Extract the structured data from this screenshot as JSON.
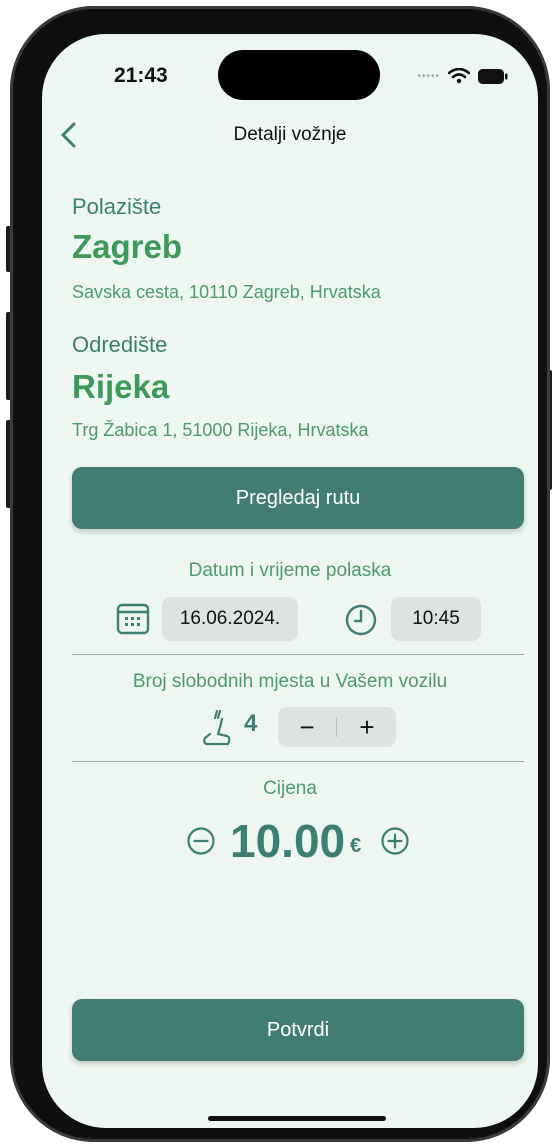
{
  "status_bar": {
    "time": "21:43"
  },
  "nav": {
    "title": "Detalji vožnje"
  },
  "departure": {
    "label": "Polazište",
    "city": "Zagreb",
    "address": "Savska cesta, 10110 Zagreb, Hrvatska"
  },
  "destination": {
    "label": "Odredište",
    "city": "Rijeka",
    "address": "Trg Žabica 1, 51000 Rijeka, Hrvatska"
  },
  "route_button": {
    "label": "Pregledaj rutu"
  },
  "datetime": {
    "title": "Datum i vrijeme polaska",
    "date": "16.06.2024.",
    "time": "10:45"
  },
  "seats": {
    "title": "Broj slobodnih mjesta u Vašem vozilu",
    "count": "4",
    "minus": "−",
    "plus": "+"
  },
  "price": {
    "title": "Cijena",
    "value": "10.00",
    "currency": "€"
  },
  "confirm_button": {
    "label": "Potvrdi"
  },
  "colors": {
    "accent": "#427d74",
    "green_text": "#3d9a58",
    "background": "#eef6f1"
  }
}
